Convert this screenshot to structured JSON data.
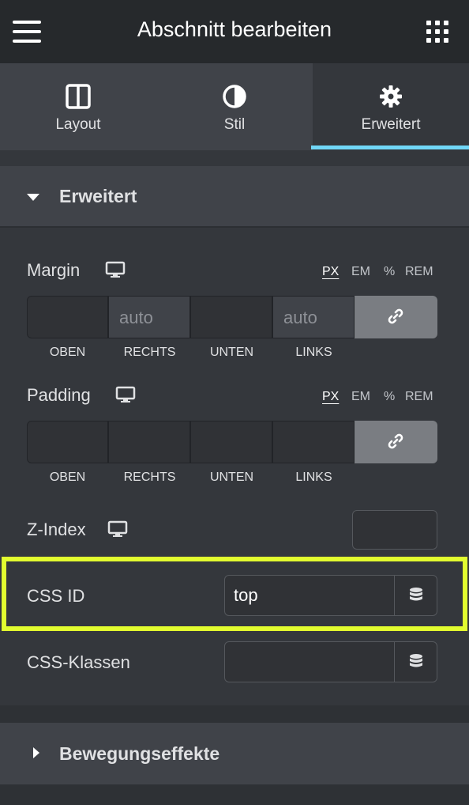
{
  "header": {
    "title": "Abschnitt bearbeiten"
  },
  "tabs": [
    {
      "label": "Layout",
      "icon": "columns-icon"
    },
    {
      "label": "Stil",
      "icon": "half-circle-icon"
    },
    {
      "label": "Erweitert",
      "icon": "gear-icon",
      "active": true
    }
  ],
  "colors": {
    "accent": "#71d7f7",
    "highlight": "#e2fd2f",
    "panel": "#34373c"
  },
  "section": {
    "title": "Erweitert",
    "margin": {
      "label": "Margin",
      "units": [
        "PX",
        "EM",
        "%",
        "REM"
      ],
      "selected_unit": "PX",
      "values": [
        "",
        "auto",
        "",
        "auto"
      ],
      "sides": [
        "OBEN",
        "RECHTS",
        "UNTEN",
        "LINKS"
      ]
    },
    "padding": {
      "label": "Padding",
      "units": [
        "PX",
        "EM",
        "%",
        "REM"
      ],
      "selected_unit": "PX",
      "values": [
        "",
        "",
        "",
        ""
      ],
      "sides": [
        "OBEN",
        "RECHTS",
        "UNTEN",
        "LINKS"
      ]
    },
    "z_index": {
      "label": "Z-Index",
      "value": ""
    },
    "css_id": {
      "label": "CSS ID",
      "value": "top"
    },
    "css_classes": {
      "label": "CSS-Klassen",
      "value": ""
    }
  },
  "section2": {
    "title": "Bewegungseffekte"
  }
}
